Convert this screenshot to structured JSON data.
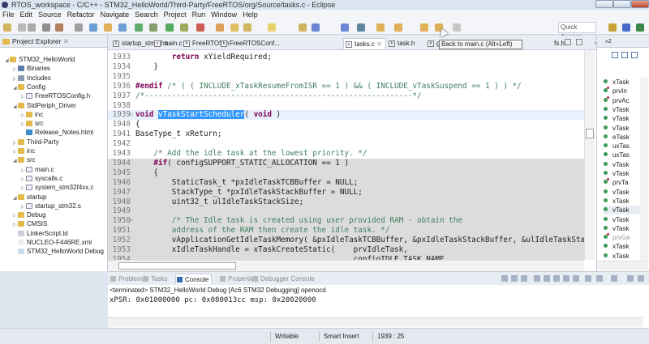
{
  "window": {
    "title": "RTOS_workspace - C/C++ - STM32_HelloWorld/Third-Party/FreeRTOS/org/Source/tasks.c - Eclipse"
  },
  "menu": [
    "File",
    "Edit",
    "Source",
    "Refactor",
    "Navigate",
    "Search",
    "Project",
    "Run",
    "Window",
    "Help"
  ],
  "toolbar": {
    "quick_access": "Quick Access",
    "tooltip": "Back to main.c (Alt+Left)"
  },
  "project_explorer": {
    "title": "Project Explorer",
    "items": [
      {
        "label": "STM32_HelloWorld",
        "depth": 0,
        "exp": "open",
        "icon": "project-icon"
      },
      {
        "label": "Binaries",
        "depth": 1,
        "exp": "closed",
        "icon": "binaries-icon"
      },
      {
        "label": "Includes",
        "depth": 1,
        "exp": "closed",
        "icon": "includes-icon"
      },
      {
        "label": "Config",
        "depth": 1,
        "exp": "open",
        "icon": "folder-icon"
      },
      {
        "label": "FreeRTOSConfig.h",
        "depth": 2,
        "exp": "closed",
        "icon": "header-file-icon"
      },
      {
        "label": "StdPeriph_Driver",
        "depth": 1,
        "exp": "open",
        "icon": "folder-icon"
      },
      {
        "label": "inc",
        "depth": 2,
        "exp": "closed",
        "icon": "folder-icon"
      },
      {
        "label": "src",
        "depth": 2,
        "exp": "closed",
        "icon": "folder-icon"
      },
      {
        "label": "Release_Notes.html",
        "depth": 2,
        "exp": "none",
        "icon": "globe-icon"
      },
      {
        "label": "Third-Party",
        "depth": 1,
        "exp": "closed",
        "icon": "folder-icon"
      },
      {
        "label": "inc",
        "depth": 1,
        "exp": "closed",
        "icon": "folder-icon"
      },
      {
        "label": "src",
        "depth": 1,
        "exp": "open",
        "icon": "folder-icon"
      },
      {
        "label": "main.c",
        "depth": 2,
        "exp": "closed",
        "icon": "c-file-icon"
      },
      {
        "label": "syscalls.c",
        "depth": 2,
        "exp": "closed",
        "icon": "c-file-icon"
      },
      {
        "label": "system_stm32f4xx.c",
        "depth": 2,
        "exp": "closed",
        "icon": "c-file-icon"
      },
      {
        "label": "startup",
        "depth": 1,
        "exp": "open",
        "icon": "folder-icon"
      },
      {
        "label": "startup_stm32.s",
        "depth": 2,
        "exp": "closed",
        "icon": "asm-file-icon"
      },
      {
        "label": "Debug",
        "depth": 1,
        "exp": "closed",
        "icon": "folder-icon"
      },
      {
        "label": "CMSIS",
        "depth": 1,
        "exp": "closed",
        "icon": "folder-icon"
      },
      {
        "label": "LinkerScript.ld",
        "depth": 1,
        "exp": "none",
        "icon": "linker-file-icon"
      },
      {
        "label": "NUCLEO-F446RE.xml",
        "depth": 1,
        "exp": "none",
        "icon": "xml-file-icon"
      },
      {
        "label": "STM32_HelloWorld Debug",
        "depth": 1,
        "exp": "none",
        "icon": "launch-config-icon"
      }
    ]
  },
  "editor": {
    "tabs": [
      {
        "label": "startup_stm32.s",
        "icon": "S"
      },
      {
        "label": "main.c",
        "icon": "c"
      },
      {
        "label": "FreeRTOS.h",
        "icon": "h"
      },
      {
        "label": "FreeRTOSConf...",
        "icon": "h"
      },
      {
        "label": "tasks.c",
        "icon": "c",
        "active": true
      },
      {
        "label": "task.h",
        "icon": "h"
      },
      {
        "label": "g",
        "icon": "h"
      },
      {
        "label": "fs.h",
        "icon": ""
      },
      {
        "label": "»6",
        "icon": ""
      }
    ],
    "lines": [
      {
        "n": "1933",
        "t": [
          [
            "",
            "        "
          ],
          [
            "kw",
            "return"
          ],
          [
            "",
            " xYieldRequired;"
          ]
        ]
      },
      {
        "n": "1934",
        "t": [
          [
            "",
            "    }"
          ]
        ]
      },
      {
        "n": "1935",
        "t": []
      },
      {
        "n": "1936",
        "t": [
          [
            "pp",
            "#endif"
          ],
          [
            "cm",
            " /* ( ( INCLUDE_xTaskResumeFromISR == 1 ) && ( INCLUDE_vTaskSuspend == 1 ) ) */"
          ]
        ]
      },
      {
        "n": "1937",
        "t": [
          [
            "cm",
            "/*-----------------------------------------------------------*/"
          ]
        ]
      },
      {
        "n": "1938",
        "t": []
      },
      {
        "n": "1939",
        "fold": true,
        "cur": true,
        "t": [
          [
            "kw",
            "void"
          ],
          [
            "",
            " "
          ],
          [
            "sel",
            "vTaskStartScheduler"
          ],
          [
            "",
            "( "
          ],
          [
            "kw",
            "void"
          ],
          [
            "",
            " )"
          ]
        ]
      },
      {
        "n": "1940",
        "t": [
          [
            "",
            "{"
          ]
        ]
      },
      {
        "n": "1941",
        "t": [
          [
            "",
            "BaseType_t xReturn;"
          ]
        ]
      },
      {
        "n": "1942",
        "t": []
      },
      {
        "n": "1943",
        "t": [
          [
            "",
            "    "
          ],
          [
            "cm",
            "/* Add the idle task at the lowest priority. */"
          ]
        ]
      },
      {
        "n": "1944",
        "inact": true,
        "t": [
          [
            "",
            "    "
          ],
          [
            "pp",
            "#if"
          ],
          [
            "",
            "( configSUPPORT_STATIC_ALLOCATION == 1 )"
          ]
        ]
      },
      {
        "n": "1945",
        "inact": true,
        "t": [
          [
            "",
            "    {"
          ]
        ]
      },
      {
        "n": "1946",
        "inact": true,
        "t": [
          [
            "",
            "        StaticTask_t *pxIdleTaskTCBBuffer = NULL;"
          ]
        ]
      },
      {
        "n": "1947",
        "inact": true,
        "t": [
          [
            "",
            "        StackType_t *pxIdleTaskStackBuffer = NULL;"
          ]
        ]
      },
      {
        "n": "1948",
        "inact": true,
        "t": [
          [
            "",
            "        uint32_t ulIdleTaskStackSize;"
          ]
        ]
      },
      {
        "n": "1949",
        "inact": true,
        "t": []
      },
      {
        "n": "1950",
        "fold": true,
        "inact": true,
        "t": [
          [
            "",
            "        "
          ],
          [
            "cm",
            "/* The Idle task is created using user provided RAM - obtain the"
          ]
        ]
      },
      {
        "n": "1951",
        "inact": true,
        "t": [
          [
            "cm",
            "        address of the RAM then create the idle task. */"
          ]
        ]
      },
      {
        "n": "1952",
        "inact": true,
        "t": [
          [
            "",
            "        vApplicationGetIdleTaskMemory( &pxIdleTaskTCBBuffer, &pxIdleTaskStackBuffer, &ulIdleTaskStackSize );"
          ]
        ]
      },
      {
        "n": "1953",
        "inact": true,
        "t": [
          [
            "",
            "        xIdleTaskHandle = xTaskCreateStatic(    prvIdleTask,"
          ]
        ]
      },
      {
        "n": "1954",
        "inact": true,
        "t": [
          [
            "",
            "                                                configIDLE_TASK_NAME,"
          ]
        ]
      }
    ]
  },
  "outline": {
    "tab": "»2",
    "items": [
      {
        "label": "xTask",
        "s": false
      },
      {
        "label": "prvIn",
        "s": true
      },
      {
        "label": "prvAc",
        "s": true
      },
      {
        "label": "vTask",
        "s": false
      },
      {
        "label": "vTask",
        "s": false
      },
      {
        "label": "vTask",
        "s": false
      },
      {
        "label": "eTask",
        "s": false
      },
      {
        "label": "uxTas",
        "s": false
      },
      {
        "label": "uxTas",
        "s": false
      },
      {
        "label": "vTask",
        "s": false
      },
      {
        "label": "vTask",
        "s": false
      },
      {
        "label": "prvTa",
        "s": true
      },
      {
        "label": "vTask",
        "s": false
      },
      {
        "label": "xTask",
        "s": false
      },
      {
        "label": "vTask",
        "s": false,
        "selected": true
      },
      {
        "label": "vTask",
        "s": false
      },
      {
        "label": "vTask",
        "s": false
      },
      {
        "label": "prvGe",
        "s": true,
        "grey": true
      },
      {
        "label": "xTask",
        "s": false
      },
      {
        "label": "xTask",
        "s": false
      }
    ]
  },
  "bottom": {
    "tabs": [
      {
        "label": "Problems"
      },
      {
        "label": "Tasks"
      },
      {
        "label": "Console",
        "active": true
      },
      {
        "label": "Properties"
      },
      {
        "label": "Debugger Console"
      }
    ],
    "terminated": "<terminated> STM32_HelloWorld Debug [Ac6 STM32 Debugging] openocd",
    "console": "xPSR: 0x01000000 pc: 0x080013cc msp: 0x20020000"
  },
  "status": {
    "writable": "Writable",
    "insert": "Smart Insert",
    "position": "1939 : 25"
  }
}
